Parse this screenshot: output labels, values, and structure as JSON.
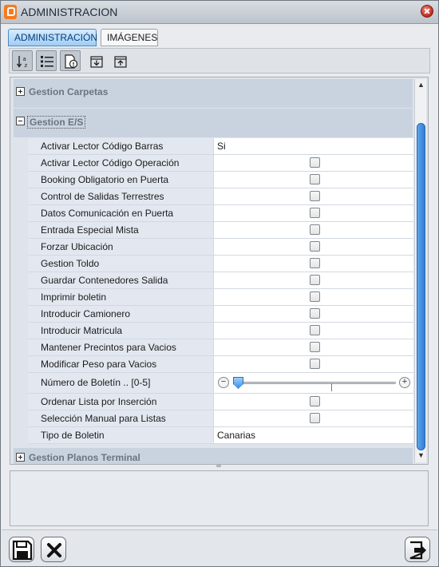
{
  "window": {
    "title": "ADMINISTRACION"
  },
  "tabs": [
    {
      "label": "ADMINISTRACIÓN",
      "active": true
    },
    {
      "label": "IMÁGENES",
      "active": false
    }
  ],
  "toolbar": {
    "buttons": [
      {
        "icon": "sort-alphabetical-icon",
        "pressed": true
      },
      {
        "icon": "categorized-list-icon",
        "pressed": true
      },
      {
        "icon": "property-pages-icon",
        "pressed": true
      },
      {
        "icon": "collapse-all-icon",
        "pressed": false
      },
      {
        "icon": "expand-all-icon",
        "pressed": false
      }
    ]
  },
  "grid": {
    "categories": [
      {
        "label": "Gestion Carpetas",
        "expanded": false
      },
      {
        "label": "Gestion E/S",
        "expanded": true
      },
      {
        "label": "Gestion Planos Terminal",
        "expanded": false
      }
    ],
    "properties": [
      {
        "label": "Activar Lector Código Barras",
        "type": "text",
        "value": "Si"
      },
      {
        "label": "Activar Lector Código Operación",
        "type": "checkbox",
        "checked": false
      },
      {
        "label": "Booking Obligatorio en Puerta",
        "type": "checkbox",
        "checked": false
      },
      {
        "label": "Control de Salidas Terrestres",
        "type": "checkbox",
        "checked": false
      },
      {
        "label": "Datos Comunicación en Puerta",
        "type": "checkbox",
        "checked": false
      },
      {
        "label": "Entrada Especial Mista",
        "type": "checkbox",
        "checked": false
      },
      {
        "label": "Forzar Ubicación",
        "type": "checkbox",
        "checked": false
      },
      {
        "label": "Gestion Toldo",
        "type": "checkbox",
        "checked": false
      },
      {
        "label": "Guardar Contenedores Salida",
        "type": "checkbox",
        "checked": false
      },
      {
        "label": "Imprimir boletin",
        "type": "checkbox",
        "checked": false
      },
      {
        "label": "Introducir Camionero",
        "type": "checkbox",
        "checked": false
      },
      {
        "label": "Introducir Matricula",
        "type": "checkbox",
        "checked": false
      },
      {
        "label": "Mantener Precintos para Vacios",
        "type": "checkbox",
        "checked": false
      },
      {
        "label": "Modificar Peso para Vacios",
        "type": "checkbox",
        "checked": false
      },
      {
        "label": "Número de Boletín .. [0-5]",
        "type": "slider",
        "value": 0,
        "min": 0,
        "max": 5,
        "minus_symbol": "−",
        "plus_symbol": "+"
      },
      {
        "label": "Ordenar Lista por Inserción",
        "type": "checkbox",
        "checked": false
      },
      {
        "label": "Selección Manual para Listas",
        "type": "checkbox",
        "checked": false
      },
      {
        "label": "Tipo de Boletin",
        "type": "text",
        "value": "Canarias"
      }
    ]
  },
  "scrollbar": {
    "up_symbol": "▲",
    "down_symbol": "▼"
  },
  "footer": {
    "buttons": [
      {
        "icon": "save-icon"
      },
      {
        "icon": "cancel-x-icon"
      },
      {
        "icon": "exit-icon"
      }
    ]
  },
  "colors": {
    "accent": "#3d8ee0",
    "tab_active": "#9fcdf5",
    "category_bg": "#c9d3e0"
  }
}
